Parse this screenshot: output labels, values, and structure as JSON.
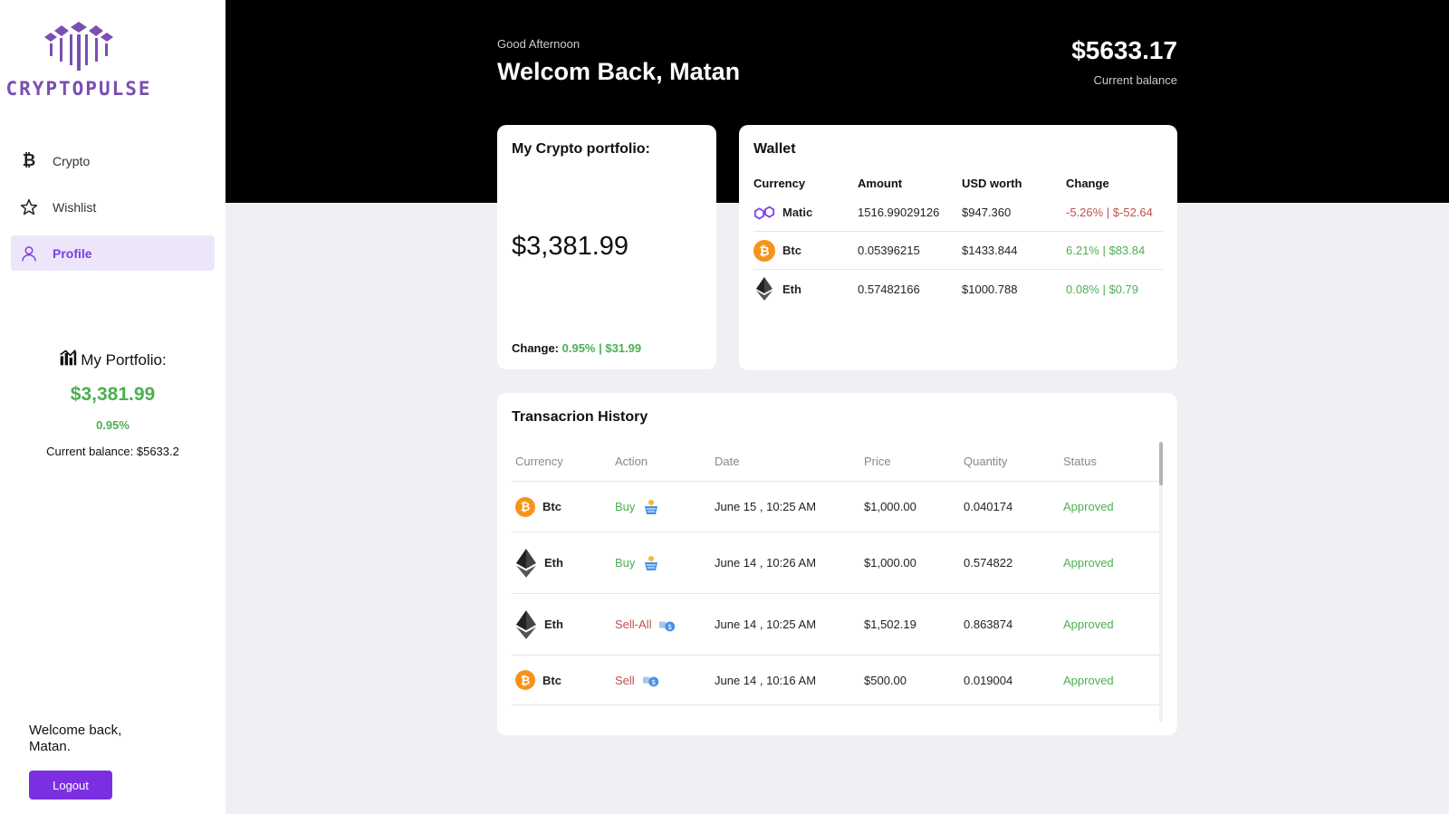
{
  "brand": {
    "name": "CRYPTOPULSE",
    "logo_icon": "cryptopulse-logo",
    "accent": "#7b2fe0"
  },
  "sidebar": {
    "items": [
      {
        "label": "Crypto",
        "icon": "bitcoin-icon",
        "active": false
      },
      {
        "label": "Wishlist",
        "icon": "star-icon",
        "active": false
      },
      {
        "label": "Profile",
        "icon": "user-icon",
        "active": true
      }
    ],
    "portfolio": {
      "title": "My Portfolio:",
      "value": "$3,381.99",
      "change": "0.95%",
      "balance": "Current balance: $5633.2"
    },
    "welcome": "Welcome back, Matan.",
    "logout_label": "Logout"
  },
  "header": {
    "greeting": "Good Afternoon",
    "welcome": "Welcom Back, Matan",
    "balance_value": "$5633.17",
    "balance_label": "Current balance"
  },
  "portfolio_card": {
    "title": "My Crypto portfolio:",
    "value": "$3,381.99",
    "change_label": "Change:",
    "change_value": "0.95% | $31.99"
  },
  "wallet": {
    "title": "Wallet",
    "columns": [
      "Currency",
      "Amount",
      "USD worth",
      "Change"
    ],
    "rows": [
      {
        "currency": "Matic",
        "icon": "matic-icon",
        "amount": "1516.99029126",
        "usd": "$947.360",
        "change": "-5.26% | $-52.64",
        "trend": "neg"
      },
      {
        "currency": "Btc",
        "icon": "bitcoin-icon",
        "amount": "0.05396215",
        "usd": "$1433.844",
        "change": "6.21% | $83.84",
        "trend": "pos"
      },
      {
        "currency": "Eth",
        "icon": "ethereum-icon",
        "amount": "0.57482166",
        "usd": "$1000.788",
        "change": "0.08% | $0.79",
        "trend": "pos"
      }
    ]
  },
  "transactions": {
    "title": "Transacrion History",
    "columns": [
      "Currency",
      "Action",
      "Date",
      "Price",
      "Quantity",
      "Status"
    ],
    "rows": [
      {
        "currency": "Btc",
        "icon": "bitcoin-icon",
        "action": "Buy",
        "action_type": "buy",
        "action_icon": "basket-icon",
        "date": "June 15 , 10:25 AM",
        "price": "$1,000.00",
        "quantity": "0.040174",
        "status": "Approved"
      },
      {
        "currency": "Eth",
        "icon": "ethereum-icon",
        "action": "Buy",
        "action_type": "buy",
        "action_icon": "basket-icon",
        "date": "June 14 , 10:26 AM",
        "price": "$1,000.00",
        "quantity": "0.574822",
        "status": "Approved"
      },
      {
        "currency": "Eth",
        "icon": "ethereum-icon",
        "action": "Sell-All",
        "action_type": "sell",
        "action_icon": "coin-hand-icon",
        "date": "June 14 , 10:25 AM",
        "price": "$1,502.19",
        "quantity": "0.863874",
        "status": "Approved"
      },
      {
        "currency": "Btc",
        "icon": "bitcoin-icon",
        "action": "Sell",
        "action_type": "sell",
        "action_icon": "coin-hand-icon",
        "date": "June 14 , 10:16 AM",
        "price": "$500.00",
        "quantity": "0.019004",
        "status": "Approved"
      }
    ]
  },
  "colors": {
    "positive": "#4caf50",
    "negative": "#c0504d",
    "header_bg": "#000000",
    "page_bg": "#eff0f4"
  }
}
